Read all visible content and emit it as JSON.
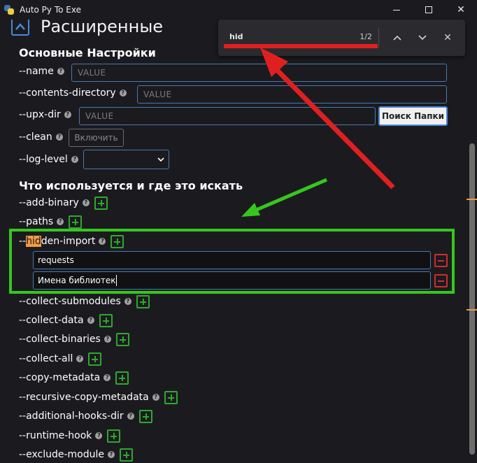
{
  "window": {
    "title": "Auto Py To Exe",
    "minimize_glyph": "—",
    "maximize_glyph": "☐",
    "close_glyph": "✕"
  },
  "section": {
    "title": "Расширенные",
    "icon": "chevron-up-icon"
  },
  "basic_settings": {
    "heading": "Основные Настройки",
    "name": {
      "label": "--name",
      "placeholder": "VALUE"
    },
    "contents_directory": {
      "label": "--contents-directory",
      "placeholder": "VALUE"
    },
    "upx_dir": {
      "label": "--upx-dir",
      "placeholder": "VALUE",
      "browse_label": "Поиск Папки"
    },
    "clean": {
      "label": "--clean",
      "toggle_label": "Включить"
    },
    "log_level": {
      "label": "--log-level",
      "value": ""
    }
  },
  "what_used": {
    "heading": "Что используется и где это искать",
    "add_binary": "--add-binary",
    "paths": "--paths",
    "hidden_import": {
      "label_match": "hid",
      "label_rest": "den-import",
      "prefix": "--",
      "entries": [
        "requests",
        "Имена библиотек"
      ]
    },
    "collect_submodules": "--collect-submodules",
    "collect_data": "--collect-data",
    "collect_binaries": "--collect-binaries",
    "collect_all": "--collect-all",
    "copy_metadata": "--copy-metadata",
    "recursive_copy_metadata": "--recursive-copy-metadata",
    "additional_hooks_dir": "--additional-hooks-dir",
    "runtime_hook": "--runtime-hook",
    "exclude_module": "--exclude-module"
  },
  "find_bar": {
    "query": "hid",
    "count": "1/2",
    "prev_glyph": "⌃",
    "next_glyph": "⌄",
    "close_glyph": "✕"
  },
  "colors": {
    "background": "#1b1b1f",
    "accent_blue": "#4a89d6",
    "plus_green": "#2fa82f",
    "minus_red": "#d02c2c",
    "find_highlight": "#f39a44",
    "annotation_green": "#35c71e",
    "annotation_red": "#e02020"
  }
}
